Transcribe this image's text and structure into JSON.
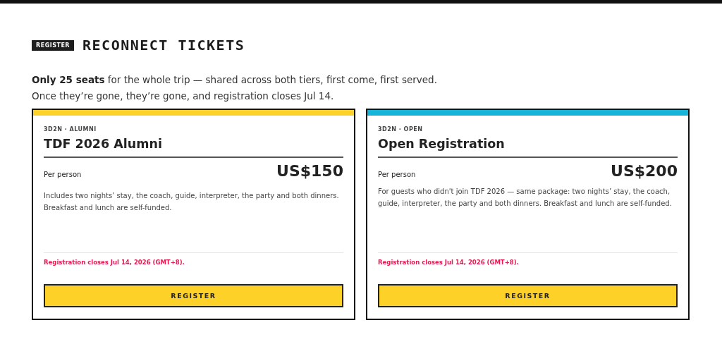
{
  "header": {
    "tag": "REGISTER",
    "title": "RECONNECT TICKETS"
  },
  "intro": [
    "**Only 25 seats** for the whole trip — shared across both tiers, first come, first served.",
    "Once they’re gone, they’re gone, and registration closes Jul 14."
  ],
  "tiers": [
    {
      "eyebrow": "3D2N · ALUMNI",
      "name": "TDF 2026 Alumni",
      "color": "#fcd12a",
      "unit": "Per person",
      "price": "US$150",
      "description": "Includes two nights’ stay, the coach, guide, interpreter, the party and both dinners. Breakfast and lunch are self-funded.",
      "deadline": "Registration closes Jul 14, 2026 (GMT+8).",
      "button": "REGISTER"
    },
    {
      "eyebrow": "3D2N · OPEN",
      "name": "Open Registration",
      "color": "#16b4d8",
      "unit": "Per person",
      "price": "US$200",
      "description": "For guests who didn't join TDF 2026 — same package: two nights’ stay, the coach, guide, interpreter, the party and both dinners. Breakfast and lunch are self-funded.",
      "deadline": "Registration closes Jul 14, 2026 (GMT+8).",
      "button": "REGISTER"
    }
  ]
}
